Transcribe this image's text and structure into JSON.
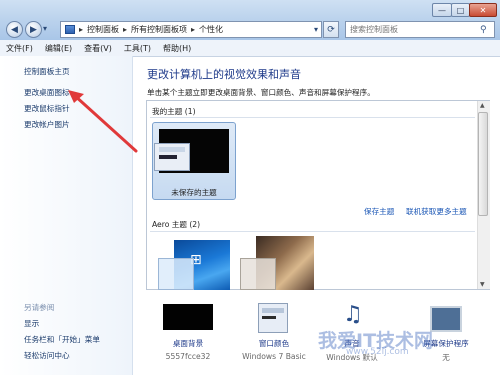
{
  "window": {
    "minimize_glyph": "—",
    "maximize_glyph": "□",
    "close_glyph": "✕"
  },
  "nav": {
    "back_glyph": "◀",
    "forward_glyph": "▶",
    "dropdown_glyph": "▾",
    "refresh_glyph": "⟳"
  },
  "address": {
    "segments": [
      "控制面板",
      "所有控制面板项",
      "个性化"
    ],
    "separator": "▸"
  },
  "search": {
    "placeholder": "搜索控制面板"
  },
  "menu": {
    "items": [
      "文件(F)",
      "编辑(E)",
      "查看(V)",
      "工具(T)",
      "帮助(H)"
    ]
  },
  "sidebar": {
    "links": [
      "控制面板主页",
      "更改桌面图标",
      "更改鼠标指针",
      "更改帐户图片"
    ],
    "see_also_heading": "另请参阅",
    "see_also": [
      "显示",
      "任务栏和「开始」菜单",
      "轻松访问中心"
    ]
  },
  "main": {
    "title": "更改计算机上的视觉效果和声音",
    "subtitle": "单击某个主题立即更改桌面背景、窗口颜色、声音和屏幕保护程序。",
    "my_themes_heading": "我的主题 (1)",
    "my_theme_name": "未保存的主题",
    "save_theme_link": "保存主题",
    "get_more_link": "联机获取更多主题",
    "aero_heading": "Aero 主题 (2)"
  },
  "bottom": {
    "desktop_background": {
      "label": "桌面背景",
      "sub": "5557fcce32"
    },
    "window_color": {
      "label": "窗口颜色",
      "sub": "Windows 7 Basic"
    },
    "sounds": {
      "label": "声音",
      "sub": "Windows 默认"
    },
    "screensaver": {
      "label": "屏幕保护程序",
      "sub": "无"
    }
  },
  "watermark": {
    "text": "我爱IT技术网",
    "url": "www.52ij.com"
  },
  "colors": {
    "link": "#1a3a6b",
    "title": "#1e3a8a",
    "selection": "#c6daf1",
    "arrow": "#e0393a"
  }
}
